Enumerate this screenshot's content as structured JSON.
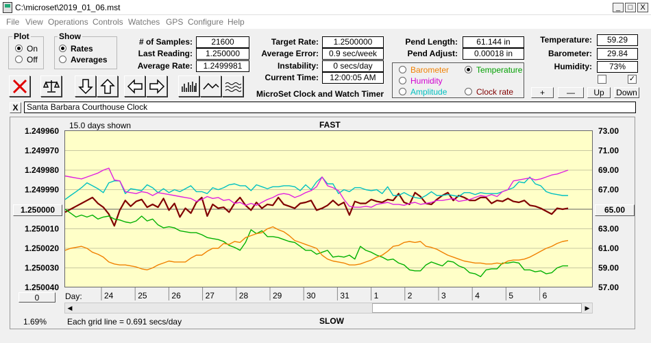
{
  "window": {
    "title": "C:\\microset\\2019_01_06.mst",
    "min": "_",
    "max": "□",
    "close": "X"
  },
  "menu": [
    "File",
    "View",
    "Operations",
    "Controls",
    "Watches",
    "GPS",
    "Configure",
    "Help"
  ],
  "plot": {
    "title": "Plot",
    "on": "On",
    "off": "Off",
    "selected": "On"
  },
  "show": {
    "title": "Show",
    "rates": "Rates",
    "averages": "Averages",
    "selected": "Rates"
  },
  "stats": {
    "samples_label": "# of Samples:",
    "samples": "21600",
    "last_label": "Last Reading:",
    "last": "1.250000",
    "avgrate_label": "Average Rate:",
    "avgrate": "1.2499981",
    "target_label": "Target Rate:",
    "target": "1.2500000",
    "avgerr_label": "Average Error:",
    "avgerr": "0.9 sec/week",
    "instab_label": "Instability:",
    "instab": "0 secs/day",
    "time_label": "Current Time:",
    "time": "12:00:05 AM",
    "pendlen_label": "Pend Length:",
    "pendlen": "61.144 in",
    "pendadj_label": "Pend Adjust:",
    "pendadj": "0.00018 in",
    "temp_label": "Temperature:",
    "temp": "59.29",
    "baro_label": "Barometer:",
    "baro": "29.84",
    "hum_label": "Humidity:",
    "hum": "73%"
  },
  "app_caption": "MicroSet Clock and Watch Timer",
  "sensors": {
    "barometer": "Barometer",
    "temperature": "Temperature",
    "humidity": "Humidity",
    "amplitude": "Amplitude",
    "clockrate": "Clock rate",
    "selected": "Temperature"
  },
  "adjust_buttons": {
    "plus": "+",
    "minus": "—",
    "up": "Up",
    "down": "Down"
  },
  "checkboxes": {
    "left": "",
    "right": "✓"
  },
  "clock_name": "Santa Barbara Courthouse Clock",
  "clear_button": "X",
  "chart_data": {
    "type": "line",
    "top_label": "FAST",
    "bottom_label": "SLOW",
    "shown": "15.0 days shown",
    "grid_note": "Each grid line = 0.691 secs/day",
    "percent": "1.69%",
    "day_label": "Day:",
    "left_ticks": [
      "1.249960",
      "1.249970",
      "1.249980",
      "1.249990",
      "1.250000",
      "1.250010",
      "1.250020",
      "1.250030",
      "1.250040"
    ],
    "right_ticks": [
      "73.00",
      "71.00",
      "69.00",
      "67.00",
      "65.00",
      "63.00",
      "61.00",
      "59.00",
      "57.00"
    ],
    "left_button": "1.250000",
    "right_button": "65.00",
    "zero_button": "0",
    "left_range": [
      1.24996,
      1.25004
    ],
    "right_range": [
      57,
      73
    ],
    "x_ticks": [
      "24",
      "25",
      "26",
      "27",
      "28",
      "29",
      "30",
      "31",
      "1",
      "2",
      "3",
      "4",
      "5",
      "6"
    ],
    "series": [
      {
        "color": "#800000",
        "values": [
          64.7,
          65.0,
          65.3,
          65.6,
          65.9,
          66.2,
          65.6,
          65.2,
          64.5,
          63.3,
          64.9,
          65.9,
          65.3,
          65.8,
          66.0,
          65.2,
          65.5,
          65.2,
          66.1,
          64.9,
          65.6,
          64.2,
          65.1,
          64.6,
          65.7,
          66.2,
          64.3,
          65.5,
          65.1,
          65.2,
          64.7,
          65.6,
          66.2,
          65.4,
          64.9,
          65.7,
          65.1,
          65.5,
          65.4,
          66.2,
          65.5,
          65.3,
          65.1,
          65.6,
          65.7,
          65.9,
          64.9,
          65.1,
          65.4,
          65.9,
          65.4,
          65.7,
          64.4,
          65.8,
          65.6,
          65.6,
          66.0,
          65.8,
          65.7,
          66.0,
          65.9,
          66.6,
          65.7,
          65.5,
          66.7,
          66.3,
          65.6,
          65.5,
          66.0,
          66.4,
          66.7,
          65.9,
          66.4,
          66.2,
          65.9,
          65.9,
          66.2,
          66.2,
          65.6,
          65.9,
          65.8,
          66.1,
          65.8,
          65.7,
          65.9,
          65.4,
          65.3,
          65.1,
          64.8,
          64.5,
          65.1,
          65.0,
          65.1
        ]
      },
      {
        "color": "#00c0c0",
        "values": [
          66.0,
          66.4,
          66.8,
          67.2,
          67.7,
          67.4,
          67.1,
          66.7,
          67.7,
          67.9,
          67.9,
          66.6,
          67.1,
          67.0,
          66.9,
          67.5,
          67.2,
          66.7,
          67.1,
          66.7,
          67.0,
          66.8,
          67.1,
          67.4,
          66.8,
          66.8,
          66.6,
          67.2,
          67.0,
          67.2,
          67.5,
          67.6,
          67.4,
          67.4,
          66.9,
          67.5,
          67.3,
          67.1,
          67.3,
          67.3,
          67.4,
          67.4,
          67.3,
          66.9,
          67.5,
          67.0,
          67.8,
          68.3,
          67.6,
          67.6,
          66.6,
          67.0,
          66.8,
          67.2,
          67.2,
          67.0,
          66.9,
          67.0,
          66.6,
          67.3,
          66.4,
          66.4,
          66.7,
          66.4,
          66.2,
          66.1,
          66.4,
          66.8,
          66.4,
          66.4,
          66.5,
          66.4,
          66.3,
          66.7,
          66.7,
          66.5,
          66.7,
          66.6,
          66.6,
          66.6,
          66.8,
          67.0,
          67.2,
          67.8,
          67.7,
          68.3,
          67.6,
          67.4,
          66.8,
          66.6,
          66.5,
          66.4,
          66.4
        ]
      },
      {
        "color": "#e020e0",
        "values": [
          68.4,
          68.3,
          68.2,
          68.1,
          68.3,
          68.5,
          68.7,
          69.0,
          69.2,
          68.0,
          67.9,
          66.8,
          66.7,
          66.6,
          66.8,
          66.7,
          66.4,
          66.7,
          66.6,
          66.5,
          66.4,
          66.3,
          66.2,
          66.1,
          65.8,
          66.0,
          66.3,
          66.1,
          66.2,
          65.9,
          66.0,
          65.6,
          65.7,
          65.4,
          65.6,
          65.4,
          65.7,
          66.0,
          66.2,
          66.5,
          66.6,
          66.5,
          66.2,
          66.4,
          66.7,
          66.9,
          67.3,
          68.3,
          67.4,
          67.2,
          66.9,
          66.0,
          65.3,
          65.2,
          65.2,
          65.3,
          65.2,
          65.5,
          65.6,
          65.7,
          65.5,
          65.5,
          65.4,
          65.6,
          65.7,
          65.5,
          65.6,
          65.7,
          65.9,
          65.9,
          66.0,
          66.1,
          65.8,
          65.9,
          66.0,
          66.2,
          66.4,
          66.3,
          66.5,
          66.3,
          66.8,
          67.0,
          67.9,
          68.0,
          68.1,
          68.2,
          68.0,
          68.1,
          68.3,
          68.5,
          68.6,
          68.8,
          69.0
        ]
      },
      {
        "color": "#00b000",
        "values": [
          65.0,
          64.6,
          64.2,
          64.4,
          64.2,
          64.4,
          64.0,
          64.2,
          64.3,
          64.0,
          63.9,
          63.7,
          63.6,
          63.8,
          64.3,
          63.8,
          64.0,
          63.4,
          63.1,
          63.2,
          63.1,
          62.8,
          62.7,
          62.6,
          62.6,
          62.4,
          62.1,
          62.0,
          61.9,
          61.7,
          61.3,
          61.1,
          60.8,
          61.6,
          62.9,
          62.5,
          62.8,
          62.2,
          62.2,
          62.1,
          61.9,
          61.7,
          61.6,
          61.2,
          60.8,
          60.8,
          60.4,
          60.6,
          60.8,
          60.1,
          60.2,
          60.1,
          60.3,
          59.9,
          61.2,
          60.8,
          60.6,
          60.3,
          60.1,
          59.8,
          59.9,
          59.5,
          59.3,
          58.8,
          58.7,
          58.7,
          59.3,
          59.6,
          59.4,
          59.2,
          59.7,
          59.6,
          59.2,
          59.0,
          58.5,
          58.4,
          58.1,
          58.8,
          58.9,
          58.9,
          59.5,
          59.5,
          59.6,
          59.5,
          58.8,
          58.8,
          58.6,
          58.7,
          58.4,
          58.5,
          59.0,
          59.2,
          59.2
        ]
      },
      {
        "color": "#f08000",
        "values": [
          60.8,
          61.0,
          61.1,
          61.2,
          61.0,
          60.6,
          60.4,
          60.1,
          59.6,
          59.4,
          59.3,
          59.3,
          59.2,
          59.1,
          58.9,
          58.8,
          59.0,
          59.3,
          59.5,
          59.7,
          59.6,
          59.6,
          59.6,
          60.0,
          60.3,
          60.3,
          60.7,
          61.0,
          61.0,
          61.5,
          61.4,
          61.7,
          61.6,
          62.1,
          62.3,
          62.5,
          62.6,
          63.0,
          63.2,
          62.9,
          62.7,
          62.3,
          61.8,
          61.6,
          61.4,
          61.2,
          61.0,
          60.3,
          59.9,
          59.7,
          59.6,
          59.5,
          59.3,
          59.3,
          59.4,
          59.6,
          59.8,
          60.1,
          60.3,
          60.7,
          61.2,
          61.3,
          61.6,
          61.7,
          61.6,
          61.7,
          61.2,
          61.1,
          60.9,
          60.6,
          60.3,
          60.1,
          59.9,
          59.7,
          59.6,
          59.5,
          59.5,
          59.4,
          59.4,
          59.5,
          59.4,
          59.7,
          59.8,
          59.8,
          59.9,
          60.1,
          60.4,
          60.7,
          61.0,
          61.2,
          61.5,
          61.7,
          61.8
        ]
      }
    ]
  }
}
